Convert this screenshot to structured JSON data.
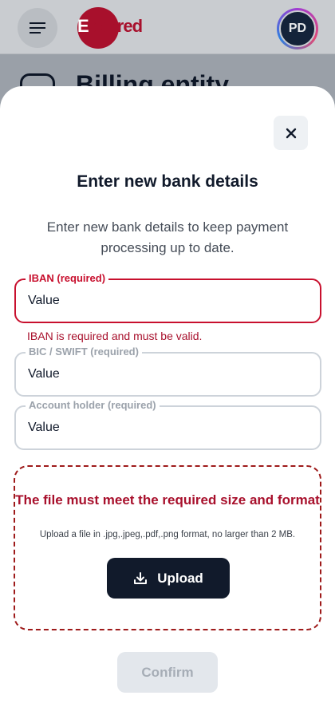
{
  "header": {
    "brand": "Edenred",
    "brand_first": "E",
    "brand_rest": "denred",
    "avatar_initials": "PD"
  },
  "background": {
    "page_title": "Billing entity"
  },
  "modal": {
    "title": "Enter new bank details",
    "description": "Enter new bank details to keep payment processing up to date.",
    "fields": [
      {
        "label": "IBAN (required)",
        "value": "Value",
        "state": "error",
        "error": "IBAN is required and must be valid."
      },
      {
        "label": "BIC / SWIFT (required)",
        "value": "Value",
        "state": "default"
      },
      {
        "label": "Account holder (required)",
        "value": "Value",
        "state": "default"
      }
    ],
    "upload": {
      "title": "The file must meet the required size and format",
      "hint": "Upload a file in .jpg,.jpeg,.pdf,.png format, no larger than 2 MB.",
      "button_label": "Upload"
    },
    "confirm_label": "Confirm",
    "confirm_disabled": true
  },
  "colors": {
    "brand": "#a8102c",
    "error": "#c8102e",
    "primary_button": "#111a2b",
    "disabled_button": "#e3e7ec"
  },
  "icons": [
    "menu-icon",
    "close-icon",
    "upload-icon",
    "back-icon"
  ]
}
